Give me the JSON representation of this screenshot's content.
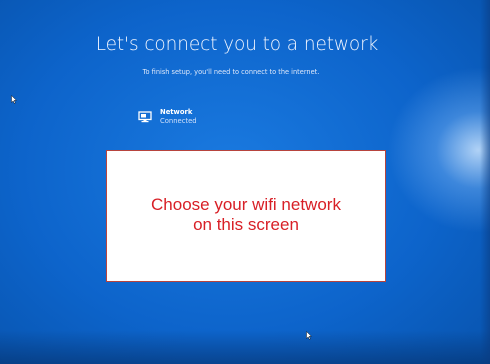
{
  "setup": {
    "title": "Let's connect you to a network",
    "subtitle": "To finish setup, you'll need to connect to the internet."
  },
  "networks": [
    {
      "name": "Network",
      "status": "Connected",
      "icon": "ethernet-monitor-icon"
    }
  ],
  "overlay": {
    "line1": "Choose your wifi network",
    "line2": "on this screen",
    "text_color": "#d81f26",
    "border_color": "#b7443e"
  },
  "theme": {
    "background": "#0a5fc2",
    "text_color": "#ffffff"
  }
}
